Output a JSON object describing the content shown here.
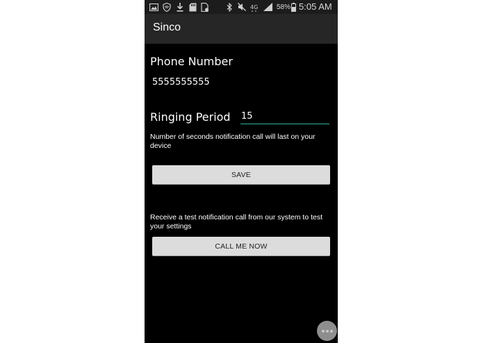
{
  "status_bar": {
    "battery_percent": "58%",
    "time": "5:05 AM",
    "icons": [
      "image-icon",
      "shield-icon",
      "download-icon",
      "sd-card-icon",
      "file-icon",
      "bluetooth-icon",
      "mute-icon",
      "data-4g-icon",
      "signal-icon",
      "battery-icon"
    ]
  },
  "action_bar": {
    "title": "Sinco"
  },
  "form": {
    "phone_label": "Phone Number",
    "phone_value": "5555555555",
    "ringing_label": "Ringing Period",
    "ringing_value": "15",
    "ringing_hint": "Number of seconds notification call will last on your device",
    "save_label": "SAVE",
    "test_hint": "Receive a test notification call from our system to test your settings",
    "call_label": "CALL ME NOW"
  },
  "colors": {
    "accent": "#2fb594",
    "background": "#000000",
    "action_bar": "#262626",
    "button": "#dcdcdc"
  }
}
